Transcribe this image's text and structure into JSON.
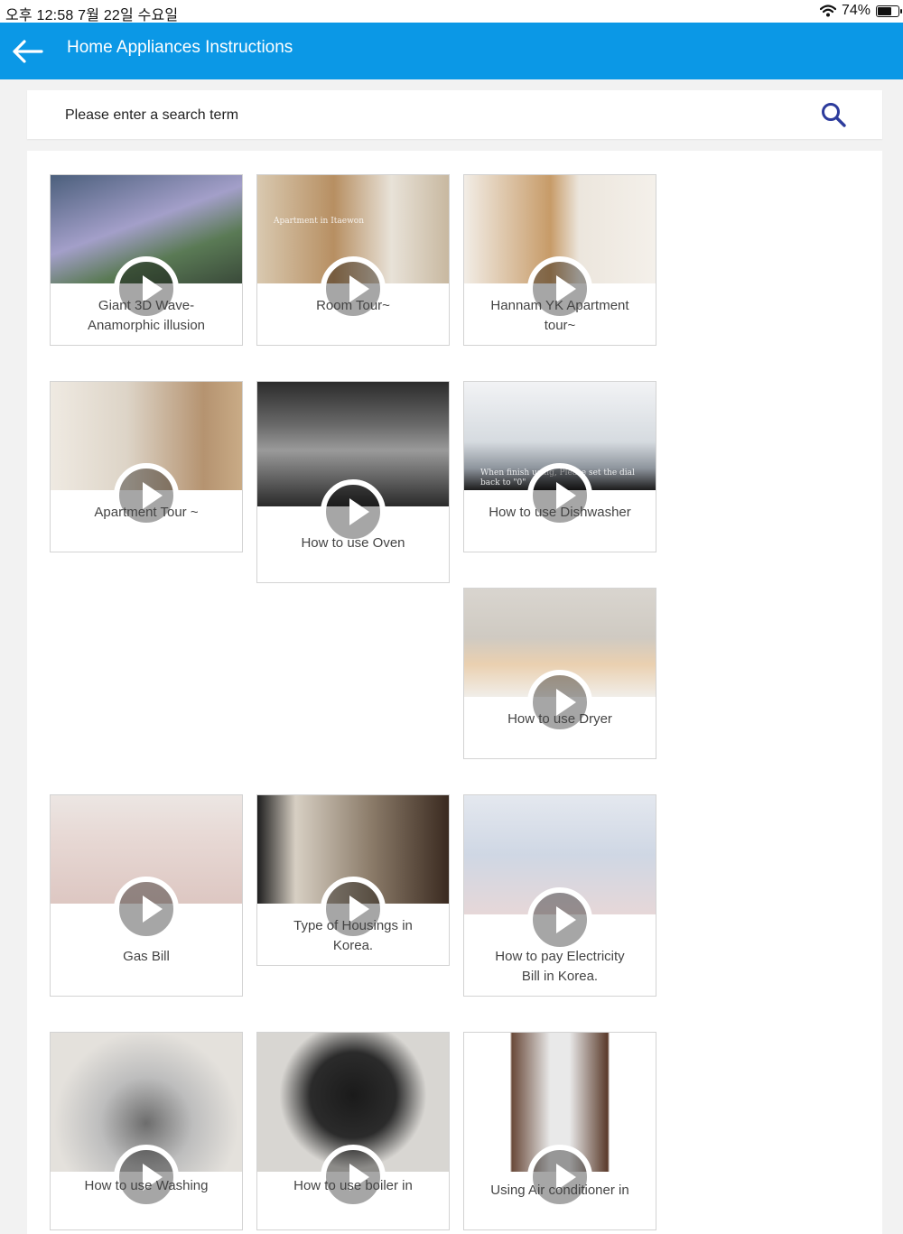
{
  "status_bar": {
    "time_date": "오후 12:58   7월 22일 수요일",
    "battery_text": "74%",
    "battery_level": 0.74
  },
  "app_bar": {
    "title": "Home Appliances Instructions"
  },
  "search": {
    "placeholder": "Please enter a search term"
  },
  "videos": [
    {
      "title_lines": [
        "Giant 3D Wave-",
        "Anamorphic illusion"
      ]
    },
    {
      "title_lines": [
        "Room Tour~"
      ],
      "overlay_text": "Apartment in Itaewon"
    },
    {
      "title_lines": [
        "Hannam YK Apartment",
        "tour~"
      ]
    },
    {
      "title_lines": [
        "Apartment Tour ~"
      ]
    },
    {
      "title_lines": [
        "How to use Oven"
      ]
    },
    {
      "title_lines": [
        "How to use Dishwasher"
      ],
      "overlay_text": "When finish using, Please set the dial back to \"0\""
    },
    {
      "title_lines": [
        "How to use Dryer"
      ]
    },
    {
      "title_lines": [
        "Gas Bill"
      ]
    },
    {
      "title_lines": [
        "Type of Housings in",
        "Korea."
      ]
    },
    {
      "title_lines": [
        "How to pay Electricity",
        "Bill in Korea."
      ]
    },
    {
      "title_lines": [
        "How to use Washing"
      ]
    },
    {
      "title_lines": [
        "How to use boiler in"
      ]
    },
    {
      "title_lines": [
        "Using Air conditioner in"
      ]
    }
  ]
}
